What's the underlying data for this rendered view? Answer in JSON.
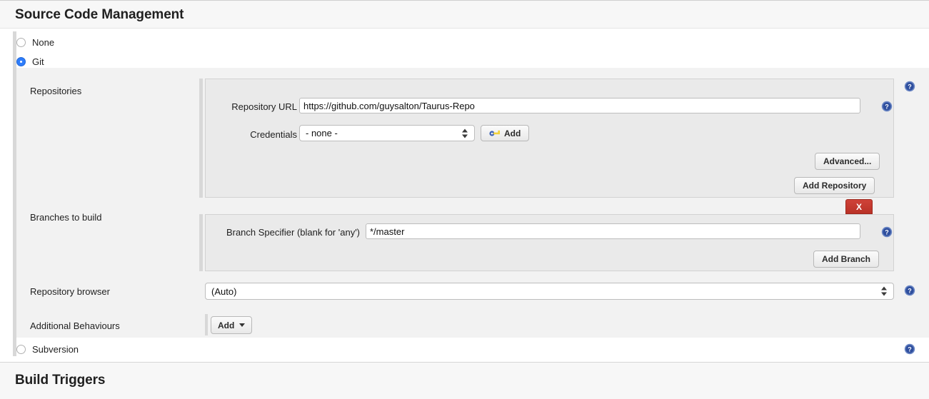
{
  "sections": {
    "scm_title": "Source Code Management",
    "build_triggers_title": "Build Triggers"
  },
  "scm_options": [
    {
      "label": "None",
      "selected": false
    },
    {
      "label": "Git",
      "selected": true
    },
    {
      "label": "Subversion",
      "selected": false
    }
  ],
  "git": {
    "repositories": {
      "row_label": "Repositories",
      "repository_url_label": "Repository URL",
      "repository_url_value": "https://github.com/guysalton/Taurus-Repo",
      "credentials_label": "Credentials",
      "credentials_value": "- none -",
      "credentials_add_label": "Add",
      "credentials_add_icon": "key-icon",
      "advanced_label": "Advanced...",
      "add_repository_label": "Add Repository"
    },
    "branches": {
      "row_label": "Branches to build",
      "branch_specifier_label": "Branch Specifier (blank for 'any')",
      "branch_specifier_value": "*/master",
      "delete_label": "X",
      "add_branch_label": "Add Branch"
    },
    "repository_browser": {
      "row_label": "Repository browser",
      "value": "(Auto)"
    },
    "additional_behaviours": {
      "row_label": "Additional Behaviours",
      "add_label": "Add"
    }
  },
  "help_icon_name": "help-icon",
  "colors": {
    "accent_blue": "#2e7dfb",
    "help_blue": "#3b5ca8",
    "delete_red": "#c0392b",
    "panel_bg": "#f2f2f2",
    "inner_panel_bg": "#eaeaea"
  }
}
